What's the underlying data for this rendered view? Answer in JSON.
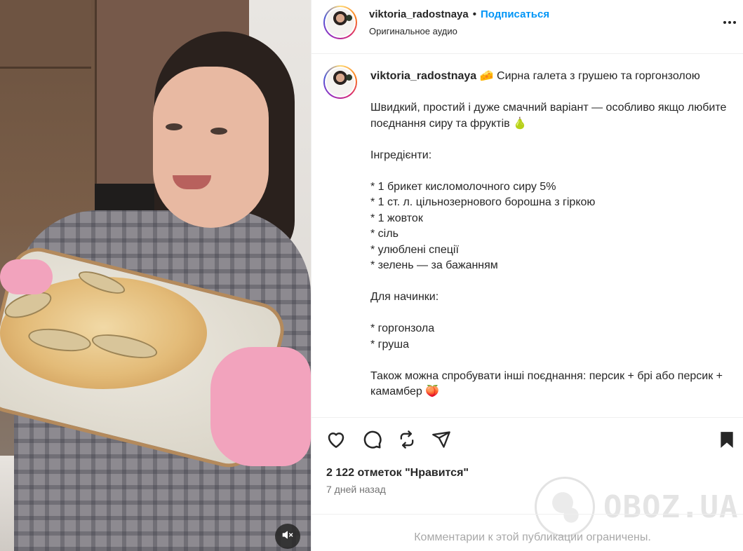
{
  "post": {
    "username": "viktoria_radostnaya",
    "separator": "•",
    "follow_label": "Подписаться",
    "audio_label": "Оригинальное аудио"
  },
  "caption": {
    "username": "viktoria_radostnaya",
    "text": "🧀 Сирна галета з грушею та горгонзолою\n\nШвидкий, простий і дуже смачний варіант — особливо якщо любите поєднання сиру та фруктів 🍐\n\nІнгредієнти:\n\n* 1 брикет кисломолочного сиру 5%\n* 1 ст. л. цільнозернового борошна з гіркою\n* 1 жовток\n* сіль\n* улюблені спеції\n* зелень — за бажанням\n\nДля начинки:\n\n* горгонзола\n* груша\n\nТакож можна спробувати інші поєднання: персик + брі або персик + камамбер 🍑"
  },
  "actions": {
    "like_icon": "heart-icon",
    "comment_icon": "comment-icon",
    "repost_icon": "repost-icon",
    "share_icon": "share-icon",
    "save_icon": "bookmark-icon"
  },
  "likes_label": "2 122 отметок \"Нравится\"",
  "time_label": "7 дней назад",
  "comments_limited": "Комментарии к этой публикации ограничены.",
  "watermark": "OBOZ.UA",
  "media": {
    "mute_icon": "mute-icon"
  },
  "colors": {
    "accent": "#0095f6",
    "text": "#262626",
    "muted": "#737373",
    "limited": "#a8a8a8"
  }
}
